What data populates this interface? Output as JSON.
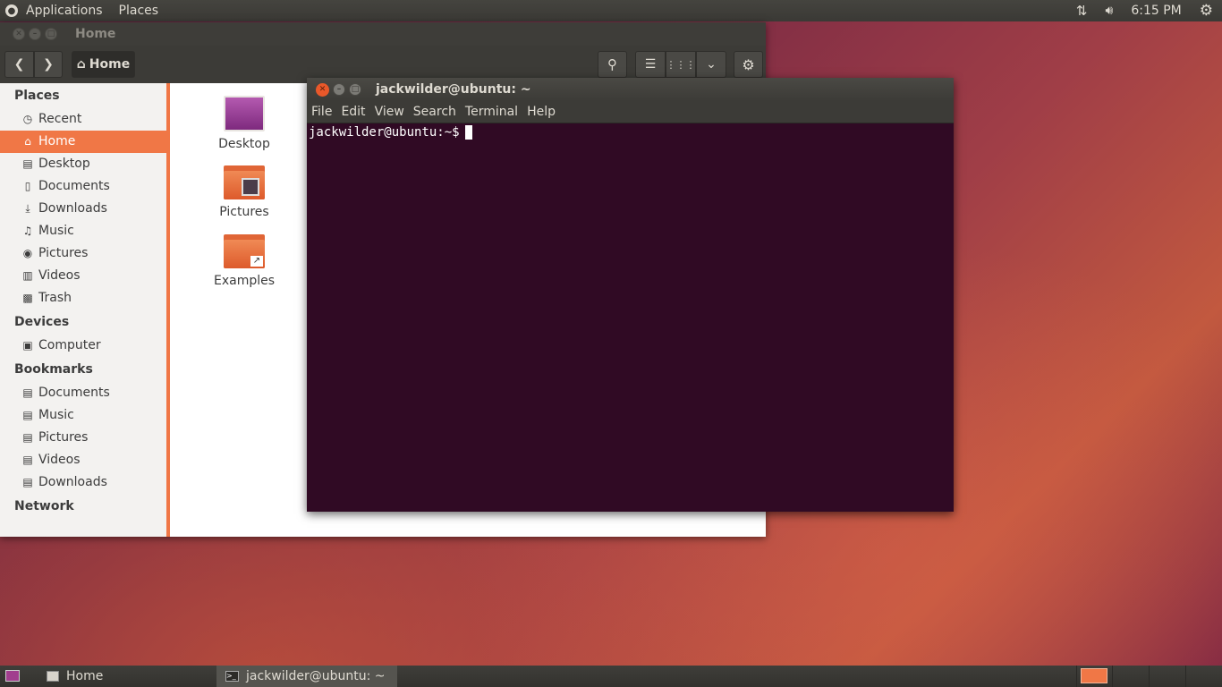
{
  "top_panel": {
    "applications": "Applications",
    "places": "Places",
    "clock": "6:15 PM"
  },
  "file_manager": {
    "title": "Home",
    "path_button": "Home",
    "sidebar": {
      "places_header": "Places",
      "places": [
        {
          "label": "Recent",
          "icon": "clock-icon",
          "glyph": "◷"
        },
        {
          "label": "Home",
          "icon": "home-icon",
          "glyph": "⌂"
        },
        {
          "label": "Desktop",
          "icon": "folder-icon",
          "glyph": "▤"
        },
        {
          "label": "Documents",
          "icon": "document-icon",
          "glyph": "▯"
        },
        {
          "label": "Downloads",
          "icon": "download-icon",
          "glyph": "⤓"
        },
        {
          "label": "Music",
          "icon": "music-icon",
          "glyph": "♫"
        },
        {
          "label": "Pictures",
          "icon": "camera-icon",
          "glyph": "◉"
        },
        {
          "label": "Videos",
          "icon": "film-icon",
          "glyph": "▥"
        },
        {
          "label": "Trash",
          "icon": "trash-icon",
          "glyph": "▩"
        }
      ],
      "devices_header": "Devices",
      "devices": [
        {
          "label": "Computer",
          "icon": "drive-icon",
          "glyph": "▣"
        }
      ],
      "bookmarks_header": "Bookmarks",
      "bookmarks": [
        {
          "label": "Documents",
          "icon": "folder-icon",
          "glyph": "▤"
        },
        {
          "label": "Music",
          "icon": "folder-icon",
          "glyph": "▤"
        },
        {
          "label": "Pictures",
          "icon": "folder-icon",
          "glyph": "▤"
        },
        {
          "label": "Videos",
          "icon": "folder-icon",
          "glyph": "▤"
        },
        {
          "label": "Downloads",
          "icon": "folder-icon",
          "glyph": "▤"
        }
      ],
      "network_header": "Network"
    },
    "files": [
      {
        "label": "Desktop"
      },
      {
        "label": "Pictures"
      },
      {
        "label": "Examples"
      }
    ]
  },
  "terminal": {
    "title": "jackwilder@ubuntu: ~",
    "menu": [
      "File",
      "Edit",
      "View",
      "Search",
      "Terminal",
      "Help"
    ],
    "prompt": "jackwilder@ubuntu:~$"
  },
  "bottom_panel": {
    "tasks": [
      {
        "label": "Home"
      },
      {
        "label": "jackwilder@ubuntu: ~"
      }
    ]
  },
  "colors": {
    "accent": "#f07746",
    "terminal_bg": "#300a24",
    "panel": "#3c3b37"
  }
}
